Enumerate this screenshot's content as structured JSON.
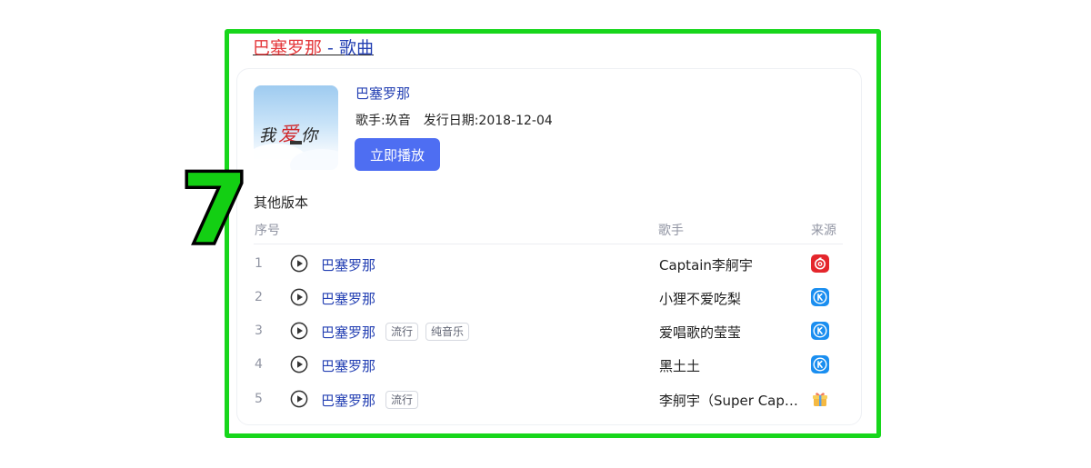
{
  "overlay_number": "7",
  "header": {
    "title_highlight": "巴塞罗那",
    "title_rest": " - 歌曲"
  },
  "song": {
    "name": "巴塞罗那",
    "singer": "歌手:玖音",
    "release": "发行日期:2018-12-04",
    "play_label": "立即播放",
    "cover_text": [
      "我",
      "爱",
      "你"
    ]
  },
  "versions": {
    "title": "其他版本",
    "headers": {
      "index": "序号",
      "singer": "歌手",
      "source": "来源"
    },
    "rows": [
      {
        "index": "1",
        "name": "巴塞罗那",
        "tags": [],
        "singer": "Captain李舸宇",
        "source": "netease-icon"
      },
      {
        "index": "2",
        "name": "巴塞罗那",
        "tags": [],
        "singer": "小狸不爱吃梨",
        "source": "kugou-icon"
      },
      {
        "index": "3",
        "name": "巴塞罗那",
        "tags": [
          "流行",
          "纯音乐"
        ],
        "singer": "爱唱歌的莹莹",
        "source": "kugou-icon"
      },
      {
        "index": "4",
        "name": "巴塞罗那",
        "tags": [],
        "singer": "黑土土",
        "source": "kugou-icon"
      },
      {
        "index": "5",
        "name": "巴塞罗那",
        "tags": [
          "流行"
        ],
        "singer": "李舸宇（Super Captain）",
        "source": "gift-box-icon"
      }
    ]
  },
  "colors": {
    "frame": "#17d61b",
    "accent": "#4e6ef2",
    "link": "#2440b3",
    "highlight": "#e4393c"
  }
}
